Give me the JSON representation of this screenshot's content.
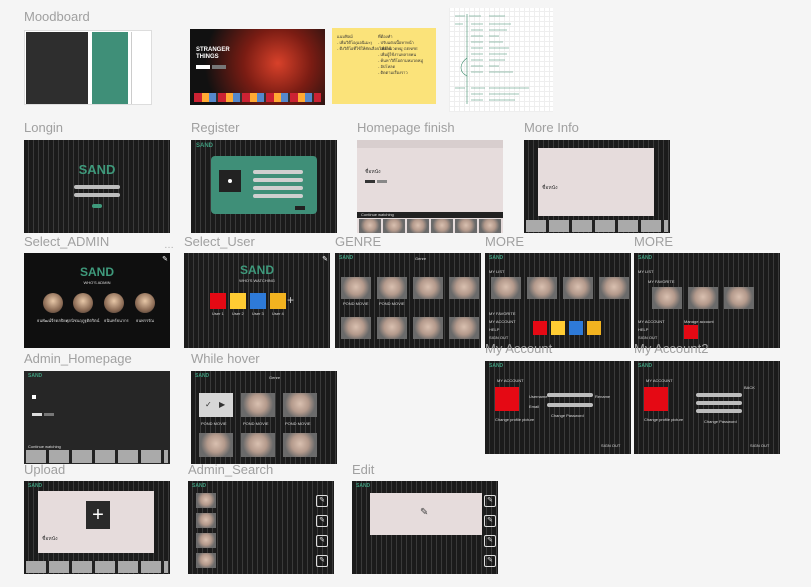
{
  "labels": {
    "moodboard": "Moodboard",
    "login": "Longin",
    "register": "Register",
    "homepage_finish": "Homepage finish",
    "more_info": "More Info",
    "select_admin": "Select_ADMIN",
    "select_user": "Select_User",
    "genre": "GENRE",
    "more1": "MORE",
    "more2": "MORE",
    "admin_homepage": "Admin_Homepage",
    "while_hover": "While hover",
    "my_account": "My Account",
    "my_account2": "My Account2",
    "upload": "Upload",
    "admin_search": "Admin_Search",
    "edit": "Edit"
  },
  "brand": "SAND",
  "select_user_title": "WHO'S WATCHING",
  "select_admin_title": "WHO'S ADMIN",
  "admin_names": [
    "ธนพัฒน์จีรดลปิยะ",
    "ศุภนิชนฤภูฐดิตริตน์",
    "ธนินทร์ธนากร",
    "ธนพรรรัณ"
  ],
  "users": [
    "User 1",
    "User 2",
    "User 3",
    "User 4"
  ],
  "moodboard_note": [
    "แนบฟิลม์",
    "- เพิ่มวิดีโอ(แอนิเมะ)",
    "- ดึงวิดีโอที่ใช้ให้คัดเลือกไฟล์ได้"
  ],
  "moodboard_note2": [
    "ที่ต้องทำ",
    "- ปรับแต่งเนื้อหาหน้า",
    "- เพิ่มหมวดหมู่ GENRE",
    "- เพิ่มผู้ใช้งานหลายคน",
    "- ค้นหาวิดีโอตามหมวดหมู่",
    "- อัปโหลด",
    "- ติดตามเรื่องราว"
  ],
  "stranger_things": "STRANGER THINGS",
  "ponds_movie": "POND MOVIE",
  "continue_watching": "Continue watching",
  "genre_label": "Genre",
  "my_list": "MY LIST",
  "my_favorite": "MY FAVORITE",
  "my_account_menu": "MY ACCOUNT",
  "help": "HELP",
  "sign_out": "SIGN OUT",
  "manage_account": "Manage account",
  "username_label": "Username",
  "email_label": "Email",
  "change_password": "Change Password",
  "change_profile": "Change profile picture",
  "rename": "Rename",
  "back": "BACK",
  "ponds_title": "ชื่อหนัง",
  "colors": {
    "bg": "#f5f5f5",
    "label": "#a0a0a0",
    "brand_green": "#3f9a7c",
    "dark": "#1f1f1f",
    "pink": "#e6dcdc",
    "sticky_yellow": "#fbe37a",
    "netflix_red": "#e50914"
  }
}
